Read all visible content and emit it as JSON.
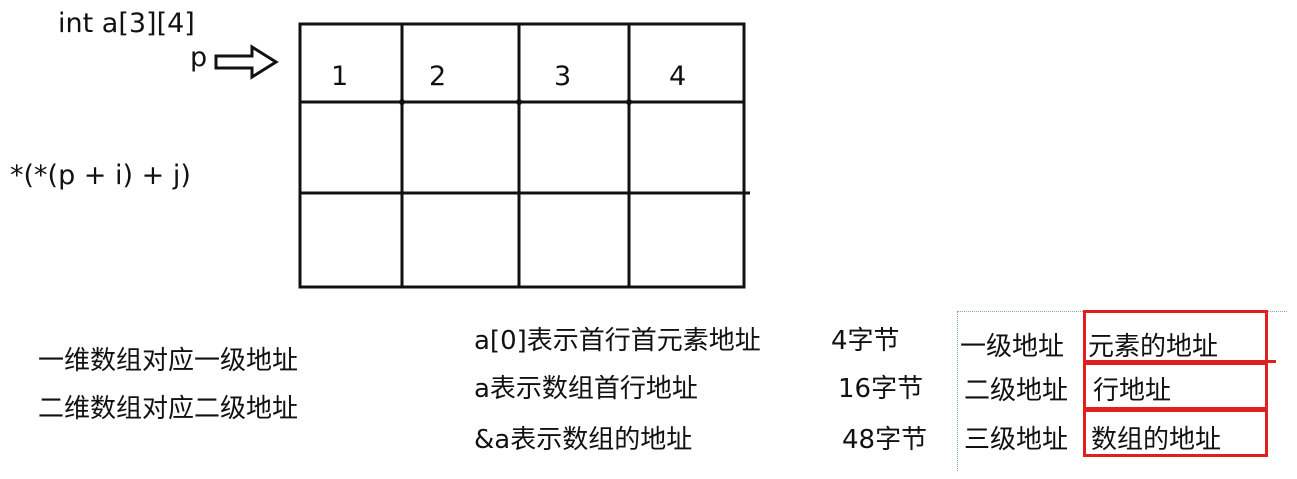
{
  "declaration": "int a[3][4]",
  "pointer_label": "p",
  "expression": "*(*(p + i) + j)",
  "grid": {
    "rows": 3,
    "cols": 4,
    "first_row_values": [
      "1",
      "2",
      "3",
      "4"
    ]
  },
  "left_notes": [
    "一维数组对应一级地址",
    "二维数组对应二级地址"
  ],
  "table": [
    {
      "meaning": "a[0]表示首行首元素地址",
      "size": "4字节",
      "level": "一级地址",
      "tag": "元素的地址"
    },
    {
      "meaning": "a表示数组首行地址",
      "size": "16字节",
      "level": "二级地址",
      "tag": "行地址"
    },
    {
      "meaning": "&a表示数组的地址",
      "size": "48字节",
      "level": "三级地址",
      "tag": "数组的地址"
    }
  ],
  "colors": {
    "ink": "#111111",
    "highlight": "#e02020",
    "selection": "#7aa7c7"
  }
}
